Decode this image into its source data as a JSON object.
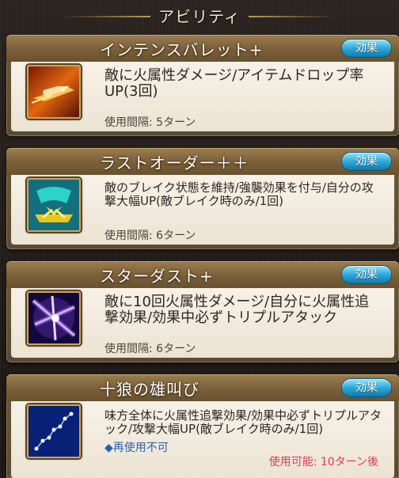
{
  "header": {
    "title": "アビリティ"
  },
  "abilities": [
    {
      "name": "インテンスバレット+",
      "effect_label": "効果",
      "description": "敵に火属性ダメージ/アイテムドロップ率UP(3回)",
      "cooldown": "使用間隔: 5ターン",
      "icon": "bullet-fire-icon"
    },
    {
      "name": "ラストオーダー＋＋",
      "effect_label": "効果",
      "description": "敵のブレイク状態を維持/強襲効果を付与/自分の攻撃大幅UP(敵ブレイク時のみ/1回)",
      "cooldown": "使用間隔: 6ターン",
      "icon": "last-order-icon"
    },
    {
      "name": "スターダスト+",
      "effect_label": "効果",
      "description": "敵に10回火属性ダメージ/自分に火属性追撃効果/効果中必ずトリプルアタック",
      "cooldown": "使用間隔: 6ターン",
      "icon": "stardust-icon"
    },
    {
      "name": "十狼の雄叫び",
      "effect_label": "効果",
      "description": "味方全体に火属性追撃効果/効果中必ずトリプルアタック/攻撃大幅UP(敵ブレイク時のみ/1回)",
      "status": "◆再使用不可",
      "available": "使用可能: 10ターン後",
      "icon": "constellation-icon"
    }
  ]
}
